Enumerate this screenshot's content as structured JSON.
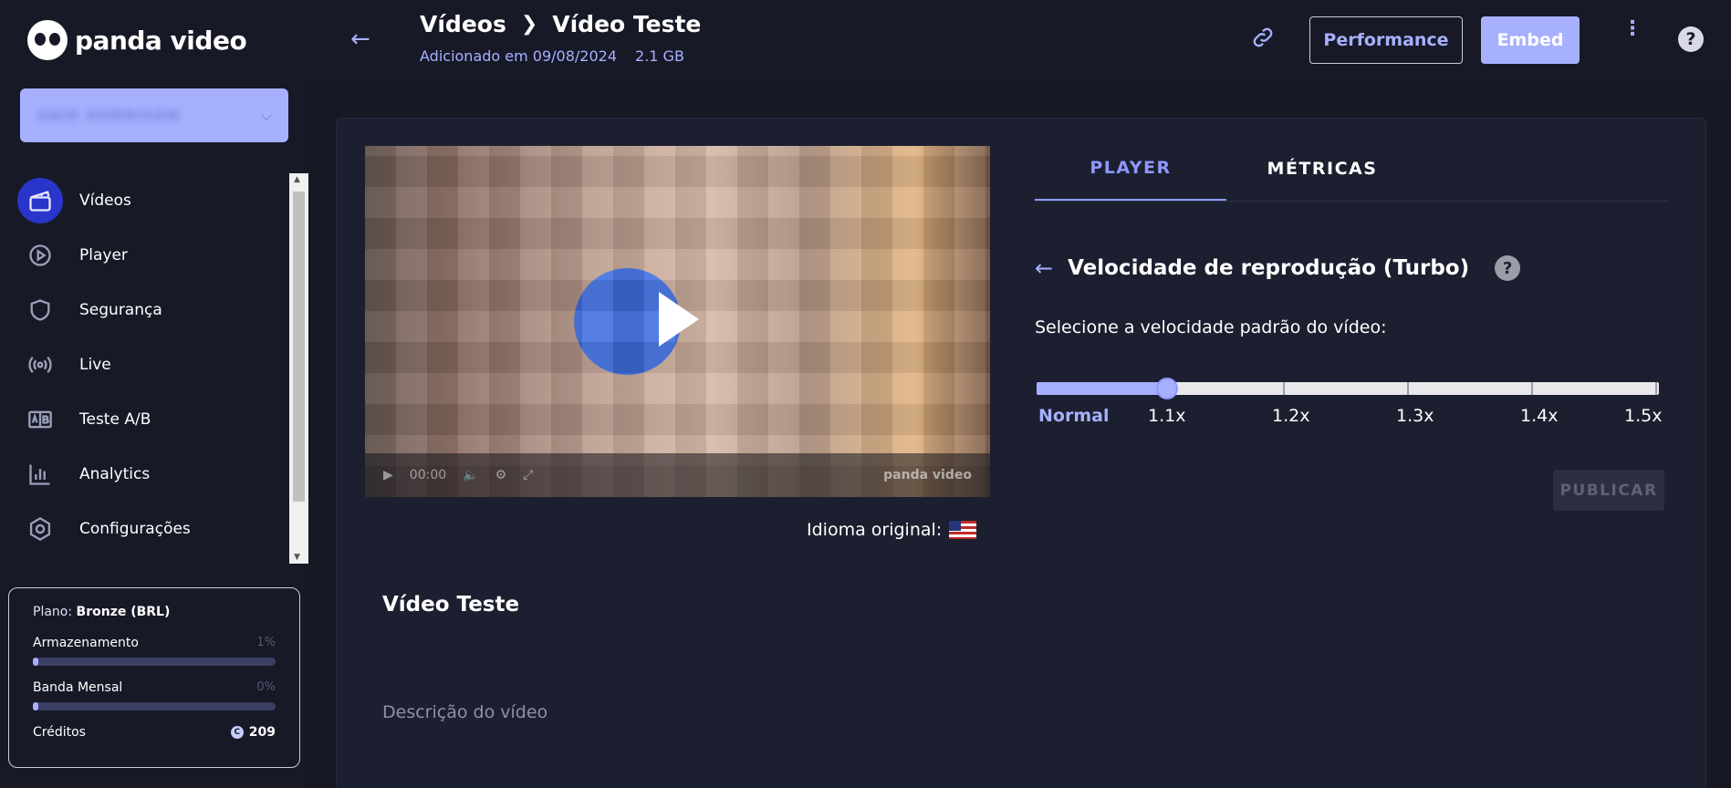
{
  "brand": {
    "name": "panda video"
  },
  "account": {
    "name": "SAID HORRISON"
  },
  "sidebar": {
    "items": [
      {
        "label": "Vídeos",
        "icon": "clapperboard-icon",
        "active": true
      },
      {
        "label": "Player",
        "icon": "play-circle-icon",
        "active": false
      },
      {
        "label": "Segurança",
        "icon": "shield-icon",
        "active": false
      },
      {
        "label": "Live",
        "icon": "broadcast-icon",
        "active": false
      },
      {
        "label": "Teste A/B",
        "icon": "ab-test-icon",
        "active": false
      },
      {
        "label": "Analytics",
        "icon": "bar-chart-icon",
        "active": false
      },
      {
        "label": "Configurações",
        "icon": "gear-icon",
        "active": false
      }
    ]
  },
  "plan": {
    "label": "Plano:",
    "name": "Bronze (BRL)",
    "storage_label": "Armazenamento",
    "storage_pct": "1%",
    "bandwidth_label": "Banda Mensal",
    "bandwidth_pct": "0%",
    "credits_label": "Créditos",
    "credits_value": "209"
  },
  "header": {
    "crumb_parent": "Vídeos",
    "crumb_current": "Vídeo Teste",
    "added": "Adicionado em 09/08/2024",
    "size": "2.1 GB",
    "performance_label": "Performance",
    "embed_label": "Embed"
  },
  "video": {
    "time": "00:00",
    "watermark": "panda video",
    "language_label": "Idioma original:",
    "title": "Vídeo Teste",
    "description_placeholder": "Descrição do vídeo"
  },
  "tabs": [
    {
      "label": "PLAYER",
      "active": true
    },
    {
      "label": "MÉTRICAS",
      "active": false
    }
  ],
  "speed": {
    "title": "Velocidade de reprodução (Turbo)",
    "prompt": "Selecione a velocidade padrão do vídeo:",
    "options": [
      "Normal",
      "1.1x",
      "1.2x",
      "1.3x",
      "1.4x",
      "1.5x"
    ],
    "selected_index": 1,
    "publish_label": "PUBLICAR"
  },
  "colors": {
    "accent": "#a7b0ff",
    "active_nav": "#2a35c9",
    "bg": "#161824"
  }
}
